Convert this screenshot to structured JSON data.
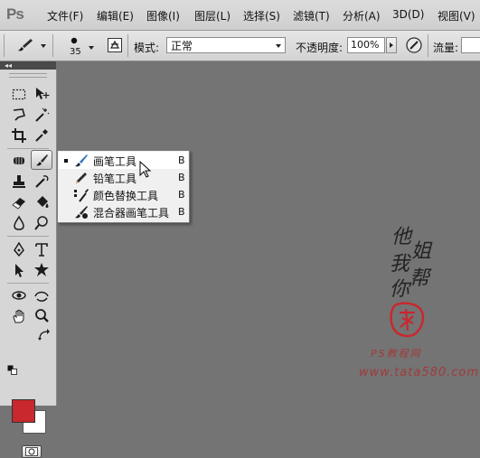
{
  "app": {
    "logo_text": "Ps",
    "menu": [
      "文件(F)",
      "编辑(E)",
      "图像(I)",
      "图层(L)",
      "选择(S)",
      "滤镜(T)",
      "分析(A)",
      "3D(D)",
      "视图(V)"
    ]
  },
  "options_bar": {
    "brush_size": "35",
    "mode_label": "模式:",
    "mode_value": "正常",
    "opacity_label": "不透明度:",
    "opacity_value": "100%",
    "flow_label": "流量:"
  },
  "flyout": {
    "items": [
      {
        "label": "画笔工具",
        "key": "B",
        "icon": "brush-icon",
        "selected": true
      },
      {
        "label": "铅笔工具",
        "key": "B",
        "icon": "pencil-icon",
        "selected": false
      },
      {
        "label": "颜色替换工具",
        "key": "B",
        "icon": "color-replacement-icon",
        "selected": false
      },
      {
        "label": "混合器画笔工具",
        "key": "B",
        "icon": "mixer-brush-icon",
        "selected": false
      }
    ]
  },
  "colors": {
    "foreground": "#c8282e",
    "background": "#ffffff",
    "canvas": "#747474"
  },
  "watermark": {
    "chars": [
      "他",
      "姐",
      "我",
      "帮",
      "你"
    ],
    "caption": "PS教程网",
    "url": "www.tata580.com"
  }
}
